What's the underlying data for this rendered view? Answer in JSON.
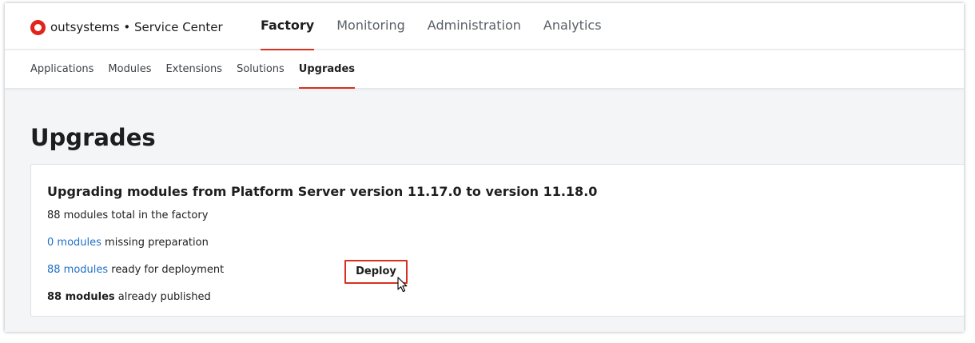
{
  "header": {
    "brand": "outsystems",
    "separator": " • ",
    "product": "Service Center",
    "tabs": [
      {
        "label": "Factory",
        "active": true
      },
      {
        "label": "Monitoring",
        "active": false
      },
      {
        "label": "Administration",
        "active": false
      },
      {
        "label": "Analytics",
        "active": false
      }
    ]
  },
  "subnav": {
    "tabs": [
      {
        "label": "Applications",
        "active": false
      },
      {
        "label": "Modules",
        "active": false
      },
      {
        "label": "Extensions",
        "active": false
      },
      {
        "label": "Solutions",
        "active": false
      },
      {
        "label": "Upgrades",
        "active": true
      }
    ]
  },
  "page": {
    "title": "Upgrades"
  },
  "upgrade_card": {
    "title": "Upgrading modules from Platform Server version 11.17.0 to version 11.18.0",
    "total_text": "88 modules total in the factory",
    "missing_link": "0 modules",
    "missing_text": " missing preparation",
    "ready_link": "88 modules",
    "ready_text": " ready for deployment",
    "deploy_label": "Deploy",
    "published_count": "88 modules",
    "published_text": " already published"
  },
  "colors": {
    "accent": "#d9301f",
    "link": "#1f6fc6",
    "logo": "#e2231a"
  },
  "icons": {
    "logo": "outsystems-logo-icon",
    "cursor": "mouse-pointer-icon"
  }
}
